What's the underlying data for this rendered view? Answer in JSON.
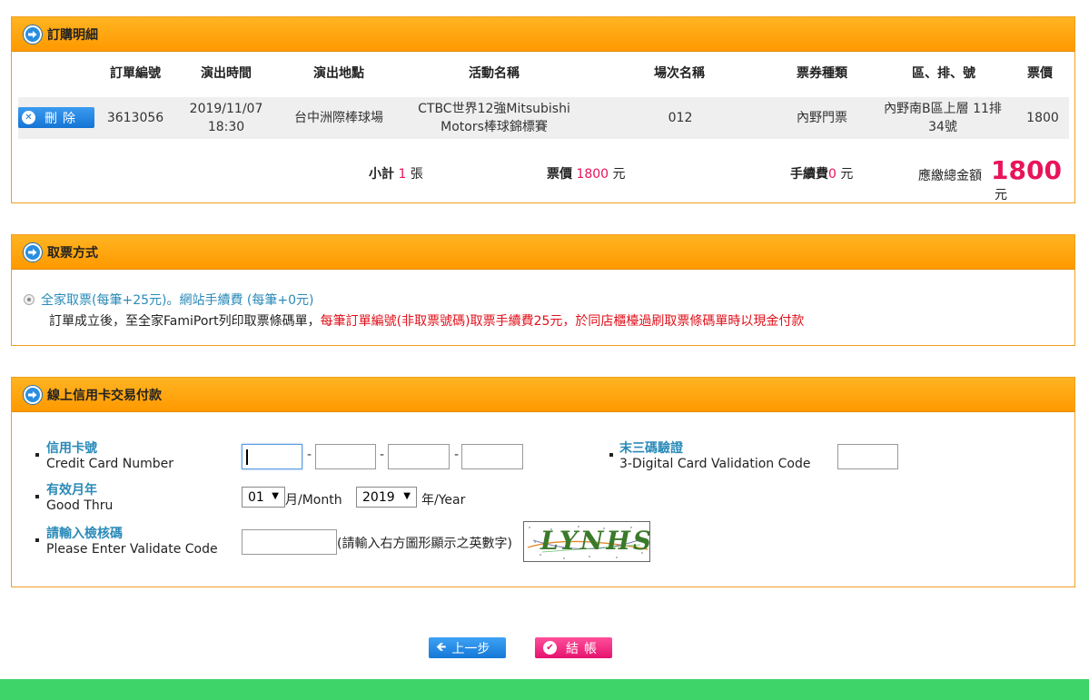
{
  "order": {
    "title": "訂購明細",
    "headers": [
      "訂單編號",
      "演出時間",
      "演出地點",
      "活動名稱",
      "場次名稱",
      "票券種類",
      "區、排、號",
      "票價"
    ],
    "delete_label": "刪除",
    "row": {
      "order_no": "3613056",
      "time_date": "2019/11/07",
      "time_clock": "18:30",
      "venue": "台中洲際棒球場",
      "event_line1": "CTBC世界12強Mitsubishi",
      "event_line2": "Motors棒球錦標賽",
      "session": "012",
      "ticket_type": "內野門票",
      "seat_line1": "內野南B區上層 11排",
      "seat_line2": "34號",
      "price": "1800"
    },
    "summary": {
      "subtotal_label": "小計",
      "subtotal_count": "1",
      "subtotal_unit": "張",
      "price_label": "票價",
      "price_value": "1800",
      "price_unit": "元",
      "fee_label": "手續費",
      "fee_value": "0",
      "fee_unit": "元",
      "total_label": "應繳總金額",
      "total_value": "1800",
      "total_unit": "元"
    }
  },
  "pickup": {
    "title": "取票方式",
    "option_label": "全家取票(每筆+25元)。網站手續費 (每筆+0元)",
    "note_normal": "訂單成立後，至全家FamiPort列印取票條碼單，",
    "note_warn": "每筆訂單編號(非取票號碼)取票手續費25元，於同店櫃檯過刷取票條碼單時以現金付款"
  },
  "payment": {
    "title": "線上信用卡交易付款",
    "card_zh": "信用卡號",
    "card_en": "Credit Card Number",
    "cvv_zh": "末三碼驗證",
    "cvv_en": "3-Digital Card Validation Code",
    "expiry_zh": "有效月年",
    "expiry_en": "Good Thru",
    "month_value": "01",
    "month_unit": "月/Month",
    "year_value": "2019",
    "year_unit": "年/Year",
    "validate_zh": "請輸入檢核碼",
    "validate_en": "Please Enter Validate Code",
    "validate_hint": "(請輸入右方圖形顯示之英數字)",
    "captcha_text": "LYNHS"
  },
  "buttons": {
    "prev": "上一步",
    "checkout": "結帳"
  },
  "colors": {
    "header_orange": "#ff9900",
    "accent_blue": "#2a8ab8",
    "price_pink": "#e8145a",
    "footer_green": "#3ed46a"
  }
}
